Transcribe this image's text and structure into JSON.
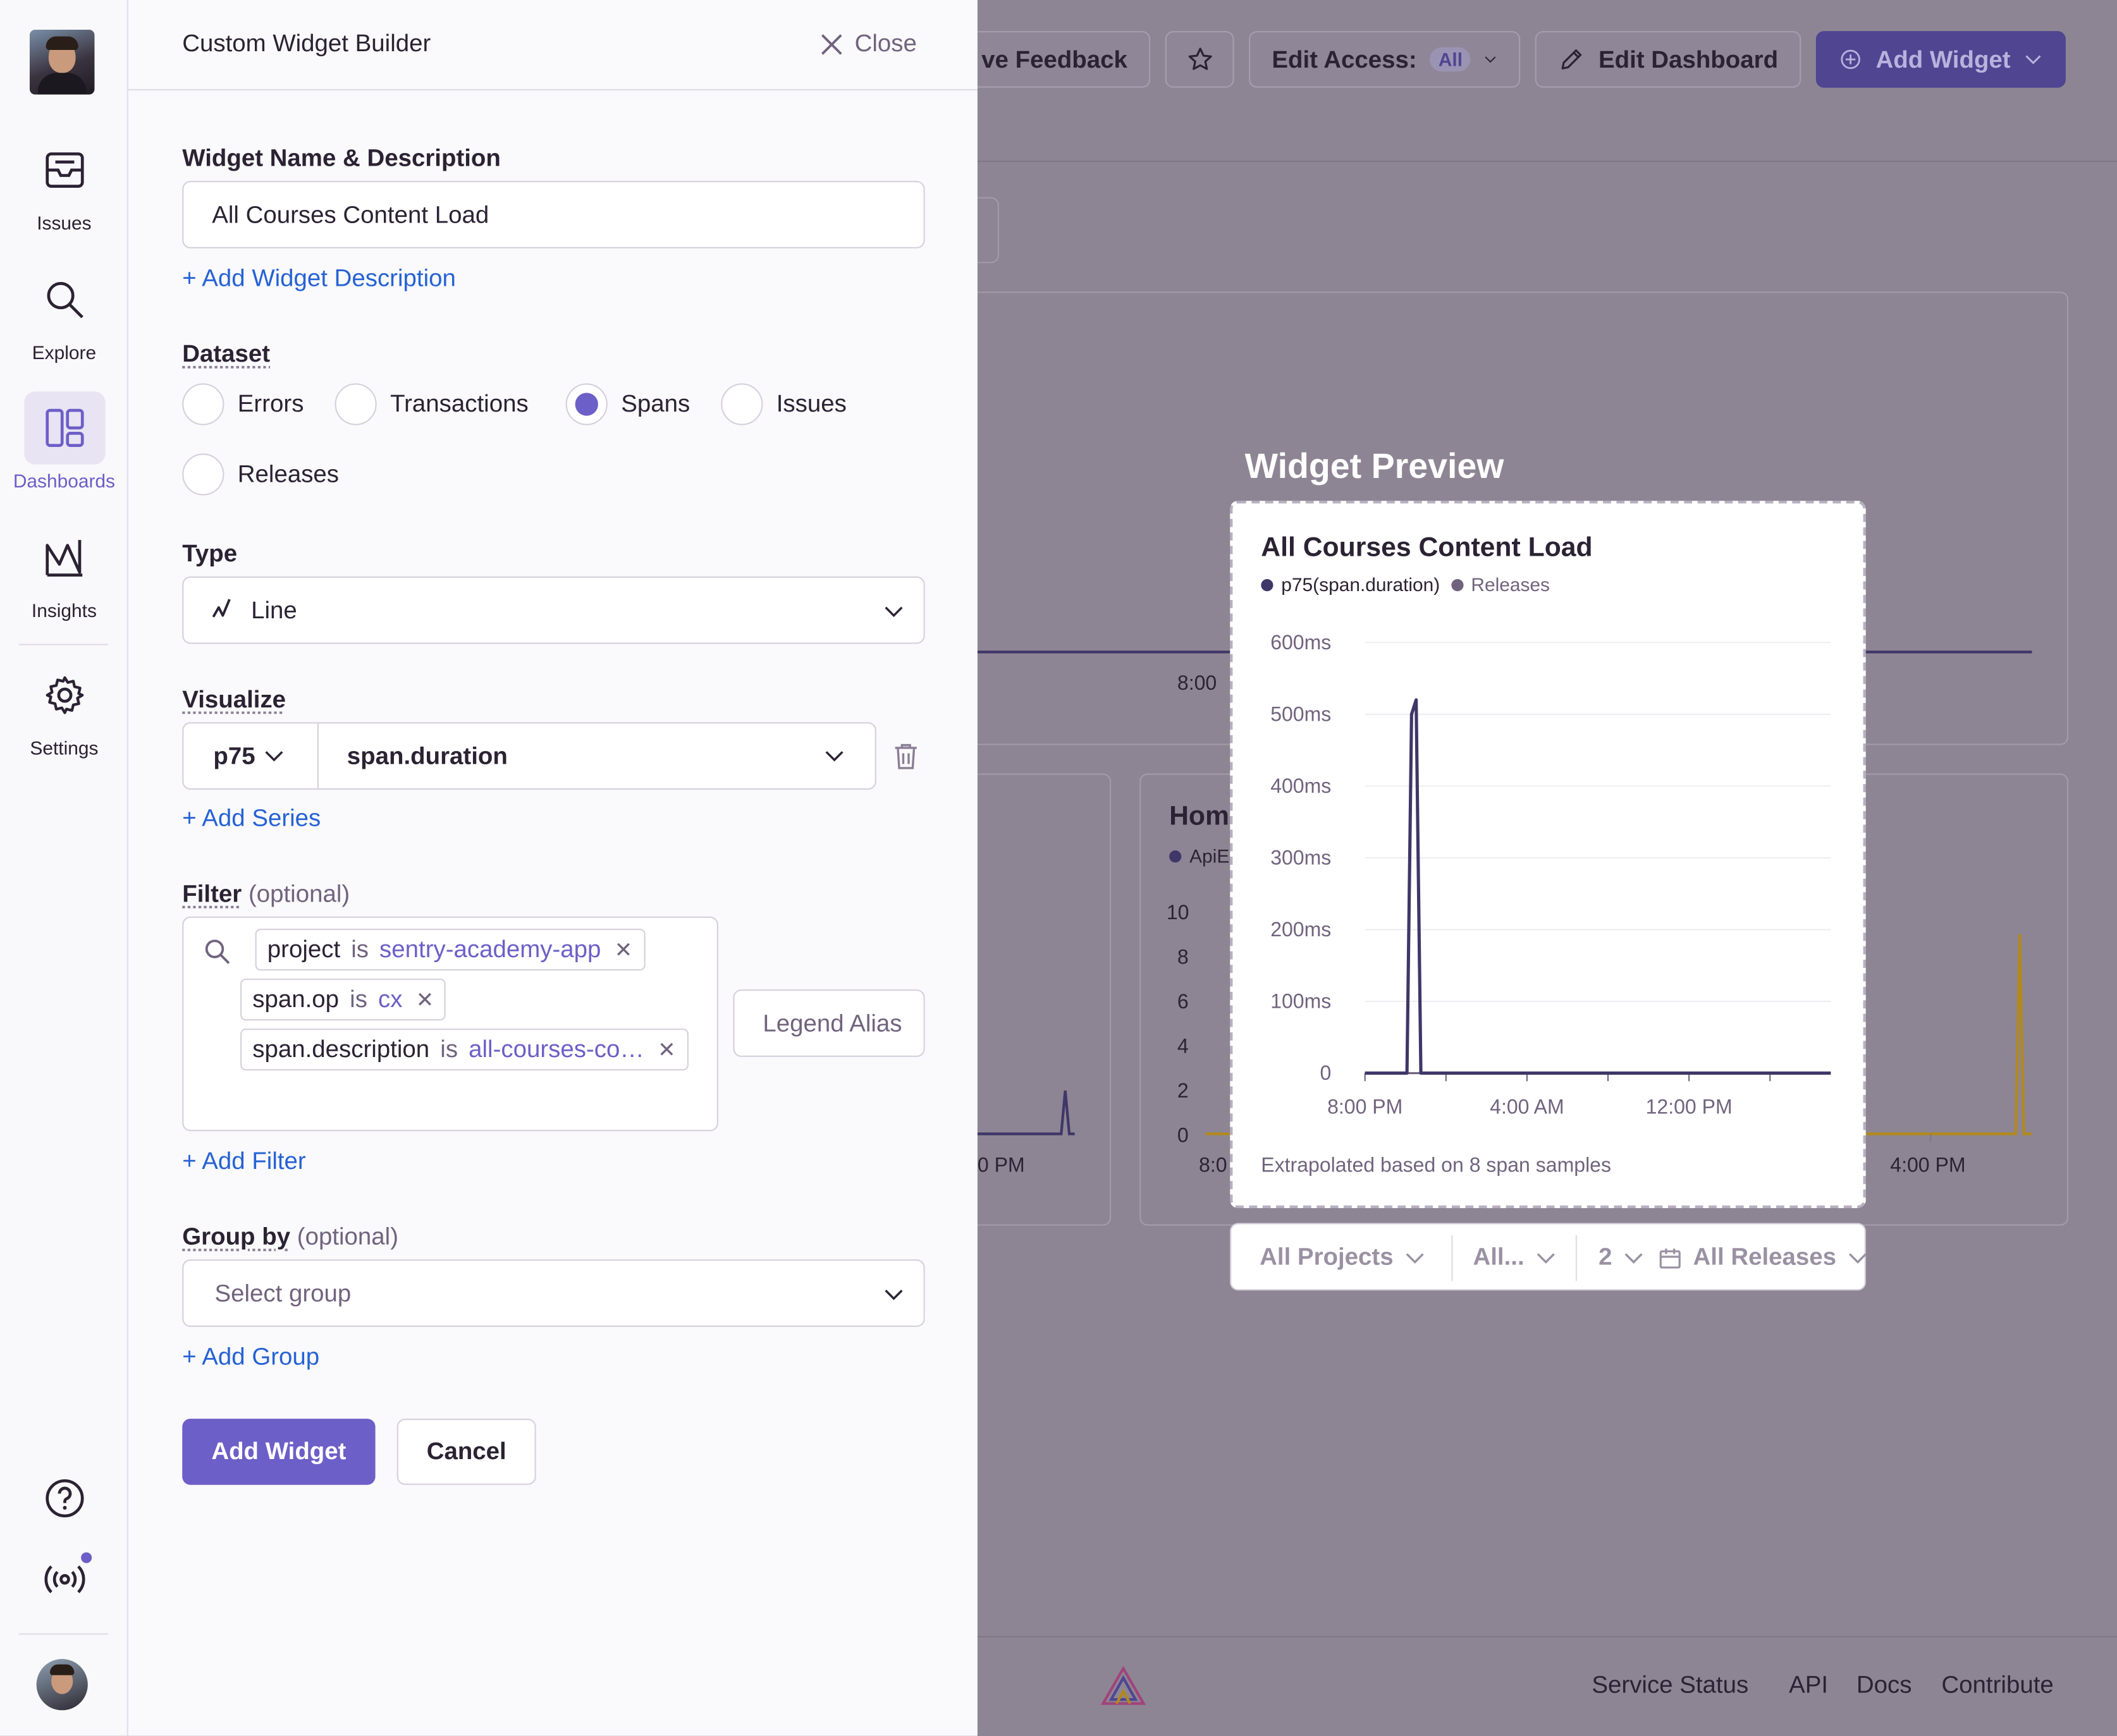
{
  "nav": {
    "items": [
      {
        "label": "Issues",
        "icon": "inbox-icon"
      },
      {
        "label": "Explore",
        "icon": "search-icon"
      },
      {
        "label": "Dashboards",
        "icon": "dashboards-icon"
      },
      {
        "label": "Insights",
        "icon": "insights-icon"
      },
      {
        "label": "Settings",
        "icon": "gear-icon"
      }
    ],
    "active": "Dashboards",
    "accent_color": "#6c5fc7"
  },
  "builder": {
    "title": "Custom Widget Builder",
    "close_label": "Close",
    "name_section_label": "Widget Name & Description",
    "widget_name": "All Courses Content Load",
    "add_description_label": "+ Add Widget Description",
    "dataset_label": "Dataset",
    "datasets": [
      "Errors",
      "Transactions",
      "Spans",
      "Issues",
      "Releases"
    ],
    "selected_dataset": "Spans",
    "type_label": "Type",
    "type_value": "Line",
    "visualize_label": "Visualize",
    "aggregate": "p75",
    "field": "span.duration",
    "add_series_label": "+ Add Series",
    "filter_label": "Filter",
    "optional_label": "(optional)",
    "filters": [
      {
        "key": "project",
        "op": "is",
        "value": "sentry-academy-app"
      },
      {
        "key": "span.op",
        "op": "is",
        "value": "cx"
      },
      {
        "key": "span.description",
        "op": "is",
        "value": "all-courses-co…"
      }
    ],
    "legend_alias_placeholder": "Legend Alias",
    "add_filter_label": "+ Add Filter",
    "group_by_label": "Group by",
    "group_placeholder": "Select group",
    "add_group_label": "+ Add Group",
    "add_widget_label": "Add Widget",
    "cancel_label": "Cancel"
  },
  "dashboard": {
    "give_feedback_label": "ve Feedback",
    "edit_access_label": "Edit Access:",
    "edit_access_value": "All",
    "edit_dashboard_label": "Edit Dashboard",
    "add_widget_label": "Add Widget",
    "bg_tick_1": "8:00",
    "bg_widget_title": "Hom",
    "bg_legend": "ApiE",
    "bg_yticks": [
      "10",
      "8",
      "6",
      "4",
      "2",
      "0"
    ],
    "bg_xtick_left": "0 PM",
    "bg_xtick_mid": "8:0",
    "bg_xtick_right": "4:00 PM",
    "footer_links": [
      "Service Status",
      "API",
      "Docs",
      "Contribute"
    ]
  },
  "preview": {
    "heading": "Widget Preview",
    "title": "All Courses Content Load",
    "legend": [
      {
        "name": "p75(span.duration)",
        "color": "#3e3768"
      },
      {
        "name": "Releases",
        "color": "#71637e"
      }
    ],
    "footnote": "Extrapolated based on 8 span samples",
    "filters": {
      "projects": "All Projects",
      "env": "All...",
      "period": "2",
      "releases": "All Releases"
    }
  },
  "chart_data": {
    "type": "line",
    "y_unit": "ms",
    "ylim": [
      0,
      600
    ],
    "yticks": [
      "0",
      "100ms",
      "200ms",
      "300ms",
      "400ms",
      "500ms",
      "600ms"
    ],
    "xticks": [
      "8:00 PM",
      "4:00 AM",
      "12:00 PM"
    ],
    "series": [
      {
        "name": "p75(span.duration)",
        "points": [
          [
            0,
            0
          ],
          [
            0.09,
            0
          ],
          [
            0.1,
            500
          ],
          [
            0.11,
            520
          ],
          [
            0.12,
            0
          ],
          [
            1,
            0
          ]
        ]
      }
    ]
  }
}
